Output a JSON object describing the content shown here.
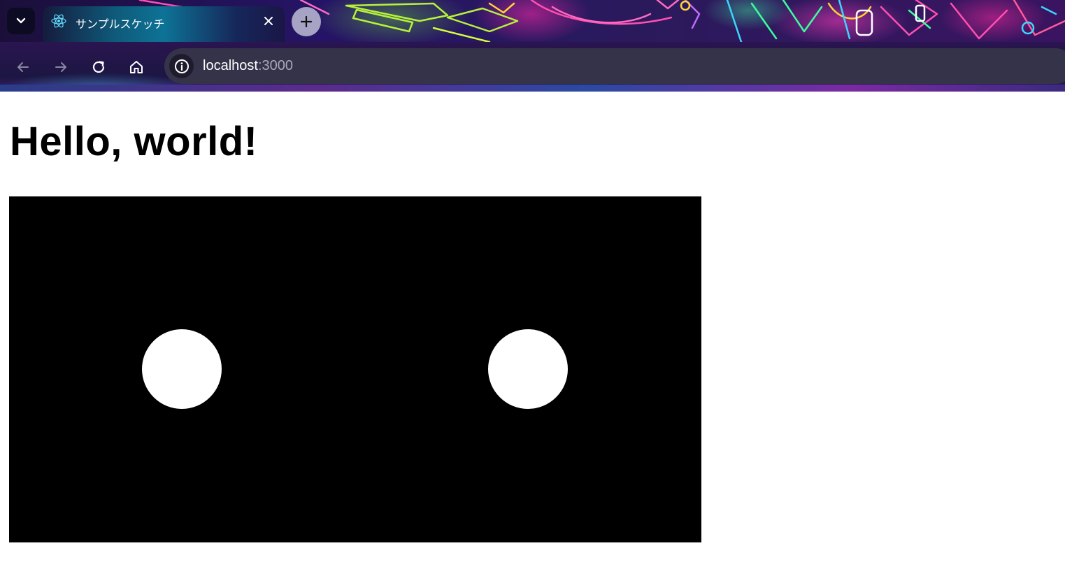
{
  "browser": {
    "tab": {
      "title": "サンプルスケッチ",
      "icon": "react-logo-icon"
    },
    "address_bar": {
      "host": "localhost",
      "port": ":3000"
    },
    "icons": {
      "tab_list": "chevron-down-icon",
      "close_tab": "close-icon",
      "new_tab": "plus-icon",
      "back": "arrow-left-icon",
      "forward": "arrow-right-icon",
      "reload": "reload-icon",
      "home": "home-icon",
      "site_info": "info-icon"
    },
    "theme_colors": {
      "frame": "#251466",
      "omnibox": "#35334a",
      "tab_accent": "#0d7396"
    }
  },
  "page": {
    "heading": "Hello, world!",
    "sketch": {
      "background": "#000000",
      "shape_color": "#ffffff",
      "shapes": [
        "circle",
        "circle"
      ]
    }
  }
}
